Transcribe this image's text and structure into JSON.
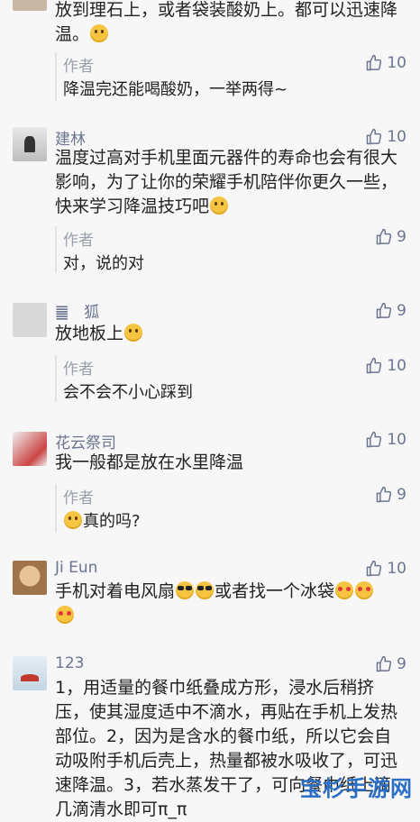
{
  "comments": [
    {
      "name": "",
      "likes": "",
      "text_line1": "放到理石上，或者袋装酸奶上。都可以迅速降",
      "text_line2": "温。",
      "reply": {
        "name": "作者",
        "likes": "10",
        "text": "降温完还能喝酸奶，一举两得~"
      }
    },
    {
      "name": "建林",
      "likes": "10",
      "text_line1": "温度过高对手机里面元器件的寿命也会有很大",
      "text_line2": "影响，为了让你的荣耀手机陪伴你更久一些，",
      "text_line3": "快来学习降温技巧吧",
      "reply": {
        "name": "作者",
        "likes": "9",
        "text": "对，说的对"
      }
    },
    {
      "name": "䷀　狐",
      "likes": "9",
      "text": "放地板上",
      "reply": {
        "name": "作者",
        "likes": "10",
        "text": "会不会不小心踩到"
      }
    },
    {
      "name": "花云祭司",
      "likes": "10",
      "text": "我一般都是放在水里降温",
      "reply": {
        "name": "作者",
        "likes": "9",
        "text": "真的吗?"
      }
    },
    {
      "name": "Ji Eun",
      "likes": "10",
      "text_a": "手机对着电风扇",
      "text_b": "或者找一个冰袋"
    },
    {
      "name": "123",
      "likes": "9",
      "text_line1": "1，用适量的餐巾纸叠成方形，浸水后稍挤",
      "text_line2": "压，使其湿度适中不滴水，再贴在手机上发热",
      "text_line3": "部位。2，因为是含水的餐巾纸，所以它会自",
      "text_line4": "动吸附手机后壳上，热量都被水吸收了，可迅",
      "text_line5": "速降温。3，若水蒸发干了，可向餐巾纸上滴",
      "text_line6": "几滴清水即可π_π"
    }
  ],
  "watermark": "宝杉手游网",
  "colors": {
    "name": "#6b7590",
    "background": "#f7f7f7",
    "watermark": "#2a6fc4"
  }
}
